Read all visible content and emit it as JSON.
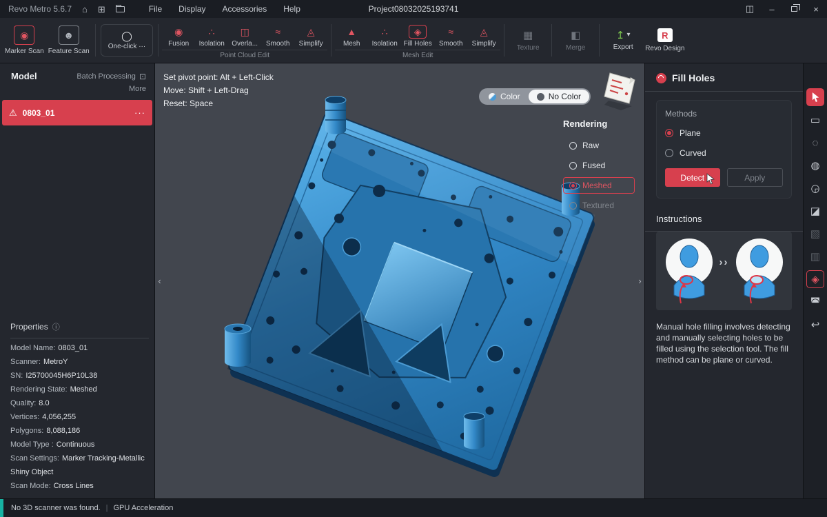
{
  "colors": {
    "accent": "#d7404e",
    "model_blue": "#3f9ce0",
    "viewport_bg": "#42464e"
  },
  "titlebar": {
    "app_title": "Revo Metro 5.6.7",
    "home_glyph": "⌂",
    "new_glyph": "⊞",
    "menus": [
      "File",
      "Display",
      "Accessories",
      "Help"
    ],
    "project_title": "Project08032025193741",
    "panels_glyph": "◫",
    "minimize_glyph": "–",
    "close_glyph": "×"
  },
  "toolbar": {
    "marker_scan": "Marker Scan",
    "marker_scan_glyph": "◉",
    "feature_scan": "Feature Scan",
    "feature_scan_glyph": "☻",
    "one_click": "One-click ···",
    "one_click_glyph": "◯",
    "point_cloud_group": {
      "label": "Point Cloud Edit",
      "items": [
        {
          "label": "Fusion",
          "glyph": "◉"
        },
        {
          "label": "Isolation",
          "glyph": "∴"
        },
        {
          "label": "Overla...",
          "glyph": "◫"
        },
        {
          "label": "Smooth",
          "glyph": "≈"
        },
        {
          "label": "Simplify",
          "glyph": "◬"
        }
      ]
    },
    "mesh_group": {
      "label": "Mesh Edit",
      "items": [
        {
          "label": "Mesh",
          "glyph": "▲"
        },
        {
          "label": "Isolation",
          "glyph": "∴"
        },
        {
          "label": "Fill Holes",
          "glyph": "◈"
        },
        {
          "label": "Smooth",
          "glyph": "≈"
        },
        {
          "label": "Simplify",
          "glyph": "◬"
        }
      ]
    },
    "texture": "Texture",
    "texture_glyph": "▦",
    "merge": "Merge",
    "merge_glyph": "◧",
    "export": "Export",
    "export_glyph": "↥",
    "export_caret": "▾",
    "revo_design": "Revo Design",
    "revo_badge": "R"
  },
  "left_panel": {
    "title": "Model",
    "batch_processing": "Batch Processing",
    "batch_glyph": "⊡",
    "more": "More",
    "model_item": {
      "name": "0803_01",
      "warn_glyph": "⚠",
      "menu_glyph": "···"
    },
    "properties": {
      "title": "Properties",
      "info_glyph": "ⓘ",
      "rows": [
        {
          "label": "Model Name:",
          "value": "0803_01"
        },
        {
          "label": "Scanner:",
          "value": "MetroY"
        },
        {
          "label": "SN:",
          "value": "I25700045H6P10L38"
        },
        {
          "label": "Rendering State:",
          "value": "Meshed"
        },
        {
          "label": "Quality:",
          "value": "8.0"
        },
        {
          "label": "Vertices:",
          "value": "4,056,255"
        },
        {
          "label": "Polygons:",
          "value": "8,088,186"
        },
        {
          "label": "Model Type :",
          "value": "Continuous"
        },
        {
          "label": "Scan Settings:",
          "value": "Marker Tracking-Metallic Shiny Object"
        },
        {
          "label": "Scan Mode:",
          "value": "Cross Lines"
        }
      ]
    }
  },
  "viewport": {
    "hints": [
      "Set pivot point: Alt + Left-Click",
      "Move: Shift + Left-Drag",
      "Reset: Space"
    ],
    "toggle": {
      "color": "Color",
      "no_color": "No Color",
      "selected": "No Color"
    },
    "rendering": {
      "title": "Rendering",
      "options": [
        {
          "label": "Raw",
          "selected": false
        },
        {
          "label": "Fused",
          "selected": false
        },
        {
          "label": "Meshed",
          "selected": true
        },
        {
          "label": "Textured",
          "selected": false,
          "disabled": true
        }
      ]
    },
    "collapse_left": "‹",
    "collapse_right": "›"
  },
  "right_panel": {
    "title": "Fill Holes",
    "methods": {
      "label": "Methods",
      "options": [
        {
          "label": "Plane",
          "selected": true
        },
        {
          "label": "Curved",
          "selected": false
        }
      ]
    },
    "detect": "Detect",
    "apply": "Apply",
    "instructions": {
      "title": "Instructions",
      "separator": "››",
      "text": "Manual hole filling involves detecting and manually selecting holes to be filled using the selection tool. The fill method can be plane or curved."
    }
  },
  "right_strip": {
    "tools": [
      {
        "name": "select-cursor",
        "glyph": ""
      },
      {
        "name": "rect-select",
        "glyph": "▭"
      },
      {
        "name": "lasso-select",
        "glyph": "◌"
      },
      {
        "name": "bubble-select",
        "glyph": "◍"
      },
      {
        "name": "sphere-select",
        "glyph": "◶"
      },
      {
        "name": "invert-select",
        "glyph": "◪"
      },
      {
        "name": "brush-select",
        "glyph": "▧"
      },
      {
        "name": "delete-select",
        "glyph": "▥"
      },
      {
        "name": "fill-holes-tool",
        "glyph": "◈"
      },
      {
        "name": "bridge-tool",
        "glyph": "◚"
      },
      {
        "name": "undo",
        "glyph": "↩"
      }
    ]
  },
  "statusbar": {
    "message": "No 3D scanner was found.",
    "separator": "|",
    "gpu": "GPU Acceleration"
  }
}
